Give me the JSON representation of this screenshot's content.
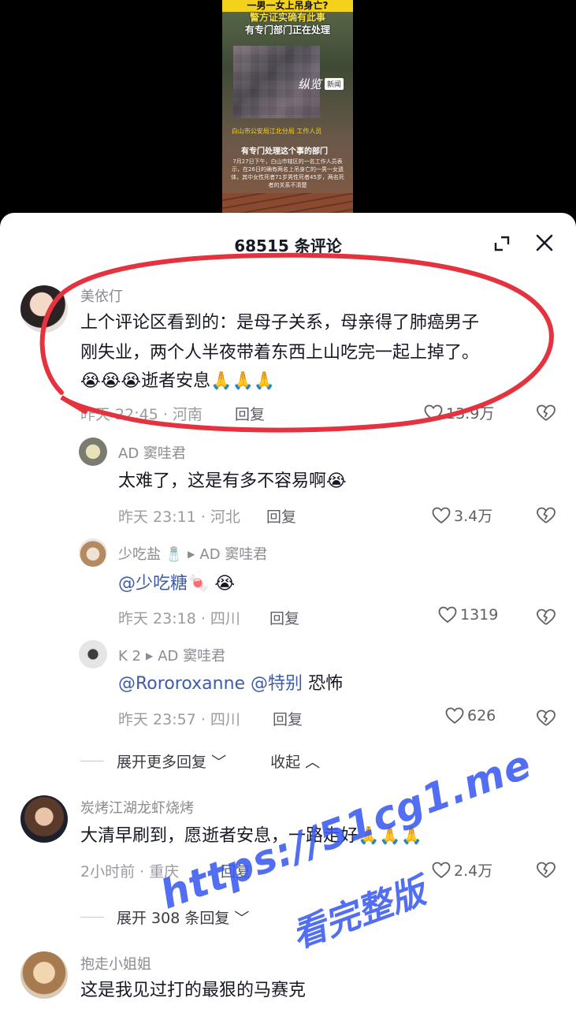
{
  "video": {
    "captions": [
      "一男一女上吊身亡?",
      "警方证实确有此事",
      "有专门部门正在处理"
    ],
    "logo": "纵览",
    "logo_badge": "新闻",
    "subtitle_small": "白山市公安局江北分局 工作人员",
    "subtitle_main": "有专门处理这个事的部门",
    "subtitle_body": "7月27日下午，白山市辖区的一名工作人员表示，在26日的确有两名上吊身亡的一男一女遗体，其中女性死者71岁男性死者45岁，两名死者的关系不清楚"
  },
  "sheet": {
    "title": "68515 条评论",
    "colors": {
      "accent_red": "#e5323f",
      "mention": "#3f5ca8",
      "watermark": "#3a5af0"
    }
  },
  "comments": [
    {
      "name": "美依仃",
      "lines": [
        "上个评论区看到的：是母子关系，母亲得了肺癌男子",
        "刚失业，两个人半夜带着东西上山吃完一起上掉了。"
      ],
      "emoji_before": "😭😭😭",
      "tail_text": "逝者安息",
      "emoji_after": "🙏🙏🙏",
      "meta": "昨天 22:45 · 河南",
      "reply": "回复",
      "likes": "13.9万"
    },
    {
      "name": "AD 窦哇君",
      "text": "太难了，这是有多不容易啊",
      "emoji": "😭",
      "meta": "昨天 23:11 · 河北",
      "reply": "回复",
      "likes": "3.4万"
    },
    {
      "name": "少吃盐",
      "name_icon": "🧂",
      "reply_to": "AD 窦哇君",
      "mention": "@少吃糖",
      "emoji": "🍬 😭",
      "meta": "昨天 23:18 · 四川",
      "reply": "回复",
      "likes": "1319"
    },
    {
      "name": "K 2",
      "reply_to": "AD 窦哇君",
      "mention1": "@Rororoxanne",
      "mention2": "@特别",
      "text": "恐怖",
      "meta": "昨天 23:57 · 四川",
      "reply": "回复",
      "likes": "626"
    },
    {
      "name": "炭烤江湖龙虾烧烤",
      "text": "大清早刷到，愿逝者安息，一路走好",
      "emoji": "🙏🙏🙏",
      "meta": "2小时前 · 重庆",
      "reply": "回复",
      "likes": "2.4万"
    },
    {
      "name": "抱走小姐姐",
      "text": "这是我见过打的最狠的马赛克"
    }
  ],
  "thread_controls": {
    "expand_more": "展开更多回复",
    "collapse": "收起",
    "expand_308": "展开 308 条回复"
  },
  "watermark": {
    "line1": "https://51cg1.me",
    "line2": "看完整版"
  }
}
